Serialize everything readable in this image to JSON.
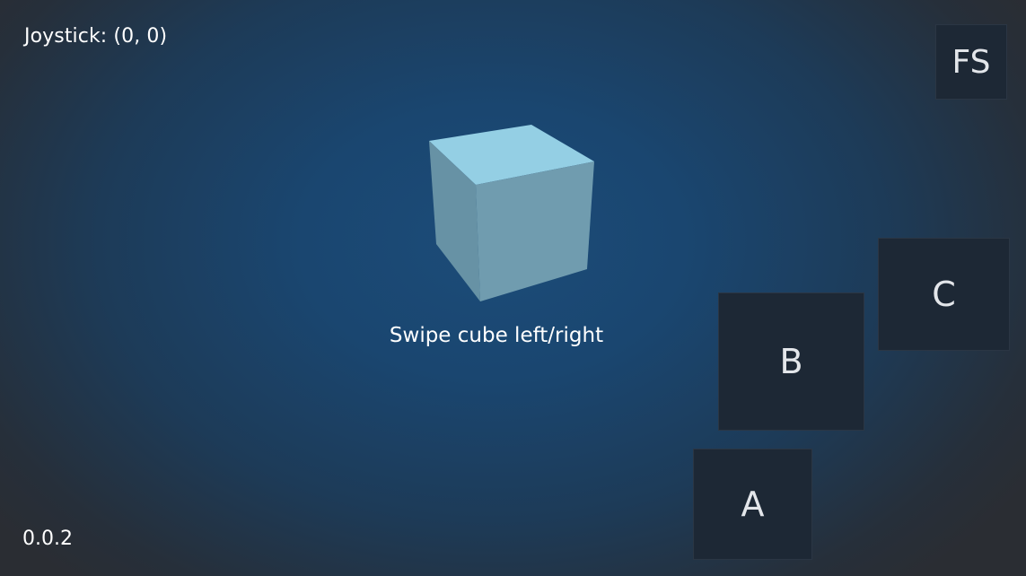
{
  "hud": {
    "joystick_readout": "Joystick: (0, 0)",
    "version": "0.0.2",
    "instruction": "Swipe cube left/right"
  },
  "buttons": {
    "fullscreen": "FS",
    "a": "A",
    "b": "B",
    "c": "C"
  },
  "cube": {
    "icon": "cube-icon",
    "colors": {
      "top": "#94cfe4",
      "left": "#6792a5",
      "right": "#709caf"
    }
  },
  "colors": {
    "background_center": "#1c4c79",
    "background_edge": "#2a2d33",
    "button_fill": "#1d2835",
    "text": "#ffffff"
  }
}
